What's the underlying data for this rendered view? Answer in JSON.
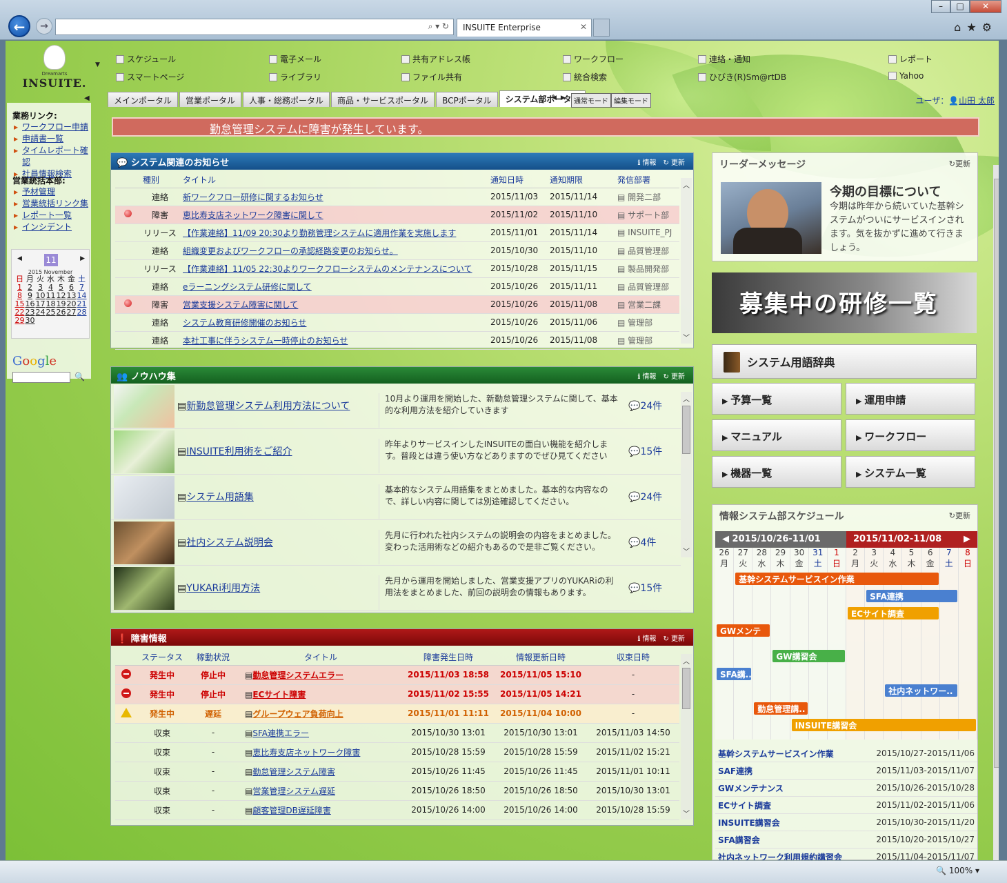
{
  "browser": {
    "tab_title": "INSUITE Enterprise",
    "address": "",
    "zoom": "100%"
  },
  "logo": {
    "sub": "Dreamarts",
    "name": "INSUITE."
  },
  "top_menu": [
    "スケジュール",
    "電子メール",
    "共有アドレス帳",
    "ワークフロー",
    "連絡・通知",
    "レポート",
    "スマートページ",
    "ライブラリ",
    "ファイル共有",
    "統合検索",
    "ひびき(R)Sm@rtDB",
    "Yahoo"
  ],
  "portal_tabs": [
    "メインポータル",
    "営業ポータル",
    "人事・総務ポータル",
    "商品・サービスポータル",
    "BCPポータル",
    "システム部ポータル"
  ],
  "active_tab": 5,
  "modes": {
    "normal": "通常モード",
    "edit": "編集モード"
  },
  "user": {
    "label": "ユーザ：",
    "name": "山田 太郎"
  },
  "sidebar": {
    "group1": {
      "title": "業務リンク:",
      "items": [
        "ワークフロー申請",
        "申請書一覧",
        "タイムレポート確認",
        "社員情報検索"
      ]
    },
    "group2": {
      "title": "営業統括本部:",
      "items": [
        "予材管理",
        "営業統括リンク集",
        "レポート一覧",
        "インシデント"
      ]
    },
    "calendar": {
      "month": "11",
      "year_month": "2015 November",
      "weekdays": [
        "日",
        "月",
        "火",
        "水",
        "木",
        "金",
        "土"
      ],
      "weeks": [
        [
          "1",
          "2",
          "3",
          "4",
          "5",
          "6",
          "7"
        ],
        [
          "8",
          "9",
          "10",
          "11",
          "12",
          "13",
          "14"
        ],
        [
          "15",
          "16",
          "17",
          "18",
          "19",
          "20",
          "21"
        ],
        [
          "22",
          "23",
          "24",
          "25",
          "26",
          "27",
          "28"
        ],
        [
          "29",
          "30",
          "",
          "",
          "",
          "",
          ""
        ]
      ]
    },
    "google": "Google"
  },
  "alert": "勤怠管理システムに障害が発生しています。",
  "panel_actions": {
    "info": "情報",
    "refresh": "更新"
  },
  "notices": {
    "title": "システム関連のお知らせ",
    "columns": [
      "種別",
      "タイトル",
      "通知日時",
      "通知期限",
      "発信部署"
    ],
    "rows": [
      {
        "type": "連絡",
        "title": "新ワークフロー研修に関するお知らせ",
        "date": "2015/11/03",
        "limit": "2015/11/14",
        "dept": "開発二部",
        "alert": false
      },
      {
        "type": "障害",
        "title": "恵比寿支店ネットワーク障害に関して",
        "date": "2015/11/02",
        "limit": "2015/11/10",
        "dept": "サポート部",
        "alert": true
      },
      {
        "type": "リリース",
        "title": "【作業連絡】11/09 20:30より勤務管理システムに適用作業を実施します",
        "date": "2015/11/01",
        "limit": "2015/11/14",
        "dept": "INSUITE_PJ",
        "alert": false
      },
      {
        "type": "連絡",
        "title": "組織変更およびワークフローの承認経路変更のお知らせ。",
        "date": "2015/10/30",
        "limit": "2015/11/10",
        "dept": "品質管理部",
        "alert": false
      },
      {
        "type": "リリース",
        "title": "【作業連絡】11/05 22:30よりワークフローシステムのメンテナンスについて",
        "date": "2015/10/28",
        "limit": "2015/11/15",
        "dept": "製品開発部",
        "alert": false
      },
      {
        "type": "連絡",
        "title": "eラーニングシステム研修に関して",
        "date": "2015/10/26",
        "limit": "2015/11/11",
        "dept": "品質管理部",
        "alert": false
      },
      {
        "type": "障害",
        "title": "営業支援システム障害に関して",
        "date": "2015/10/26",
        "limit": "2015/11/08",
        "dept": "営業二課",
        "alert": true
      },
      {
        "type": "連絡",
        "title": "システム教育研修開催のお知らせ",
        "date": "2015/10/26",
        "limit": "2015/11/06",
        "dept": "管理部",
        "alert": false
      },
      {
        "type": "連絡",
        "title": "本社工事に伴うシステム一時停止のお知らせ",
        "date": "2015/10/26",
        "limit": "2015/11/08",
        "dept": "管理部",
        "alert": false
      }
    ]
  },
  "knowhow": {
    "title": "ノウハウ集",
    "items": [
      {
        "title": "新勤怠管理システム利用方法について",
        "desc": "10月より運用を開始した、新勤怠管理システムに関して、基本的な利用方法を紹介していきます",
        "count": "24件"
      },
      {
        "title": "INSUITE利用術をご紹介",
        "desc": "昨年よりサービスインしたINSUITEの面白い機能を紹介します。普段とは違う使い方などありますのでぜひ見てください",
        "count": "15件"
      },
      {
        "title": "システム用語集",
        "desc": "基本的なシステム用語集をまとめました。基本的な内容なので、詳しい内容に関しては別途確認してください。",
        "count": "24件"
      },
      {
        "title": "社内システム説明会",
        "desc": "先月に行われた社内システムの説明会の内容をまとめました。変わった活用術などの紹介もあるので是非ご覧ください。",
        "count": "4件"
      },
      {
        "title": "YUKARi利用方法",
        "desc": "先月から運用を開始しました、営業支援アプリのYUKARiの利用法をまとめました、前回の説明会の情報もあります。",
        "count": "15件"
      }
    ]
  },
  "trouble": {
    "title": "障害情報",
    "columns": [
      "ステータス",
      "稼動状況",
      "タイトル",
      "障害発生日時",
      "情報更新日時",
      "収束日時"
    ],
    "rows": [
      {
        "status": "発生中",
        "op": "停止中",
        "title": "勤怠管理システムエラー",
        "occurred": "2015/11/03 18:58",
        "updated": "2015/11/05 15:10",
        "resolved": "-",
        "level": "error"
      },
      {
        "status": "発生中",
        "op": "停止中",
        "title": "ECサイト障害",
        "occurred": "2015/11/02 15:55",
        "updated": "2015/11/05 14:21",
        "resolved": "-",
        "level": "error"
      },
      {
        "status": "発生中",
        "op": "遅延",
        "title": "グループウェア負荷向上",
        "occurred": "2015/11/01 11:11",
        "updated": "2015/11/04 10:00",
        "resolved": "-",
        "level": "warn"
      },
      {
        "status": "収束",
        "op": "-",
        "title": "SFA連携エラー",
        "occurred": "2015/10/30 13:01",
        "updated": "2015/10/30 13:01",
        "resolved": "2015/11/03 14:50",
        "level": "ok"
      },
      {
        "status": "収束",
        "op": "-",
        "title": "恵比寿支店ネットワーク障害",
        "occurred": "2015/10/28 15:59",
        "updated": "2015/10/28 15:59",
        "resolved": "2015/11/02 15:21",
        "level": "ok"
      },
      {
        "status": "収束",
        "op": "-",
        "title": "勤怠管理システム障害",
        "occurred": "2015/10/26 11:45",
        "updated": "2015/10/26 11:45",
        "resolved": "2015/11/01 10:11",
        "level": "ok"
      },
      {
        "status": "収束",
        "op": "-",
        "title": "営業管理システム遅延",
        "occurred": "2015/10/26 18:50",
        "updated": "2015/10/26 18:50",
        "resolved": "2015/10/30 13:01",
        "level": "ok"
      },
      {
        "status": "収束",
        "op": "-",
        "title": "顧客管理DB遅延障害",
        "occurred": "2015/10/26 14:00",
        "updated": "2015/10/26 14:00",
        "resolved": "2015/10/28 15:59",
        "level": "ok"
      }
    ]
  },
  "leader": {
    "header": "リーダーメッセージ",
    "refresh": "更新",
    "title": "今期の目標について",
    "body": "今期は昨年から続いていた基幹システムがついにサービスインされます。気を抜かずに進めて行きましょう。"
  },
  "recruit": "募集中の研修一覧",
  "dictionary": "システム用語辞典",
  "quick_links": [
    "予算一覧",
    "運用申請",
    "マニュアル",
    "ワークフロー",
    "機器一覧",
    "システム一覧"
  ],
  "schedule": {
    "header": "情報システム部スケジュール",
    "refresh": "更新",
    "week1": "2015/10/26-11/01",
    "week2": "2015/11/02-11/08",
    "days": [
      [
        "26",
        "月"
      ],
      [
        "27",
        "火"
      ],
      [
        "28",
        "水"
      ],
      [
        "29",
        "木"
      ],
      [
        "30",
        "金"
      ],
      [
        "31",
        "土"
      ],
      [
        "1",
        "日"
      ],
      [
        "2",
        "月"
      ],
      [
        "3",
        "火"
      ],
      [
        "4",
        "水"
      ],
      [
        "5",
        "木"
      ],
      [
        "6",
        "金"
      ],
      [
        "7",
        "土"
      ],
      [
        "8",
        "日"
      ]
    ],
    "bars": [
      {
        "label": "基幹システムサービスイン作業",
        "color": "#e8580c"
      },
      {
        "label": "SFA連携",
        "color": "#4a80d0"
      },
      {
        "label": "ECサイト調査",
        "color": "#f0a000"
      },
      {
        "label": "GWメンテ",
        "color": "#e8580c"
      },
      {
        "label": "GW講習会",
        "color": "#48b048"
      },
      {
        "label": "SFA講..",
        "color": "#4a80d0"
      },
      {
        "label": "社内ネットワー..",
        "color": "#4a80d0"
      },
      {
        "label": "勤怠管理講..",
        "color": "#e8580c"
      },
      {
        "label": "INSUITE講習会",
        "color": "#f0a000"
      }
    ],
    "list": [
      {
        "name": "基幹システムサービスイン作業",
        "period": "2015/10/27-2015/11/06"
      },
      {
        "name": "SAF連携",
        "period": "2015/11/03-2015/11/07"
      },
      {
        "name": "GWメンテナンス",
        "period": "2015/10/26-2015/10/28"
      },
      {
        "name": "ECサイト調査",
        "period": "2015/11/02-2015/11/06"
      },
      {
        "name": "INSUITE講習会",
        "period": "2015/10/30-2015/11/20"
      },
      {
        "name": "SFA講習会",
        "period": "2015/10/20-2015/10/27"
      },
      {
        "name": "社内ネットワーク利用規約講習会",
        "period": "2015/11/04-2015/11/07"
      }
    ]
  }
}
